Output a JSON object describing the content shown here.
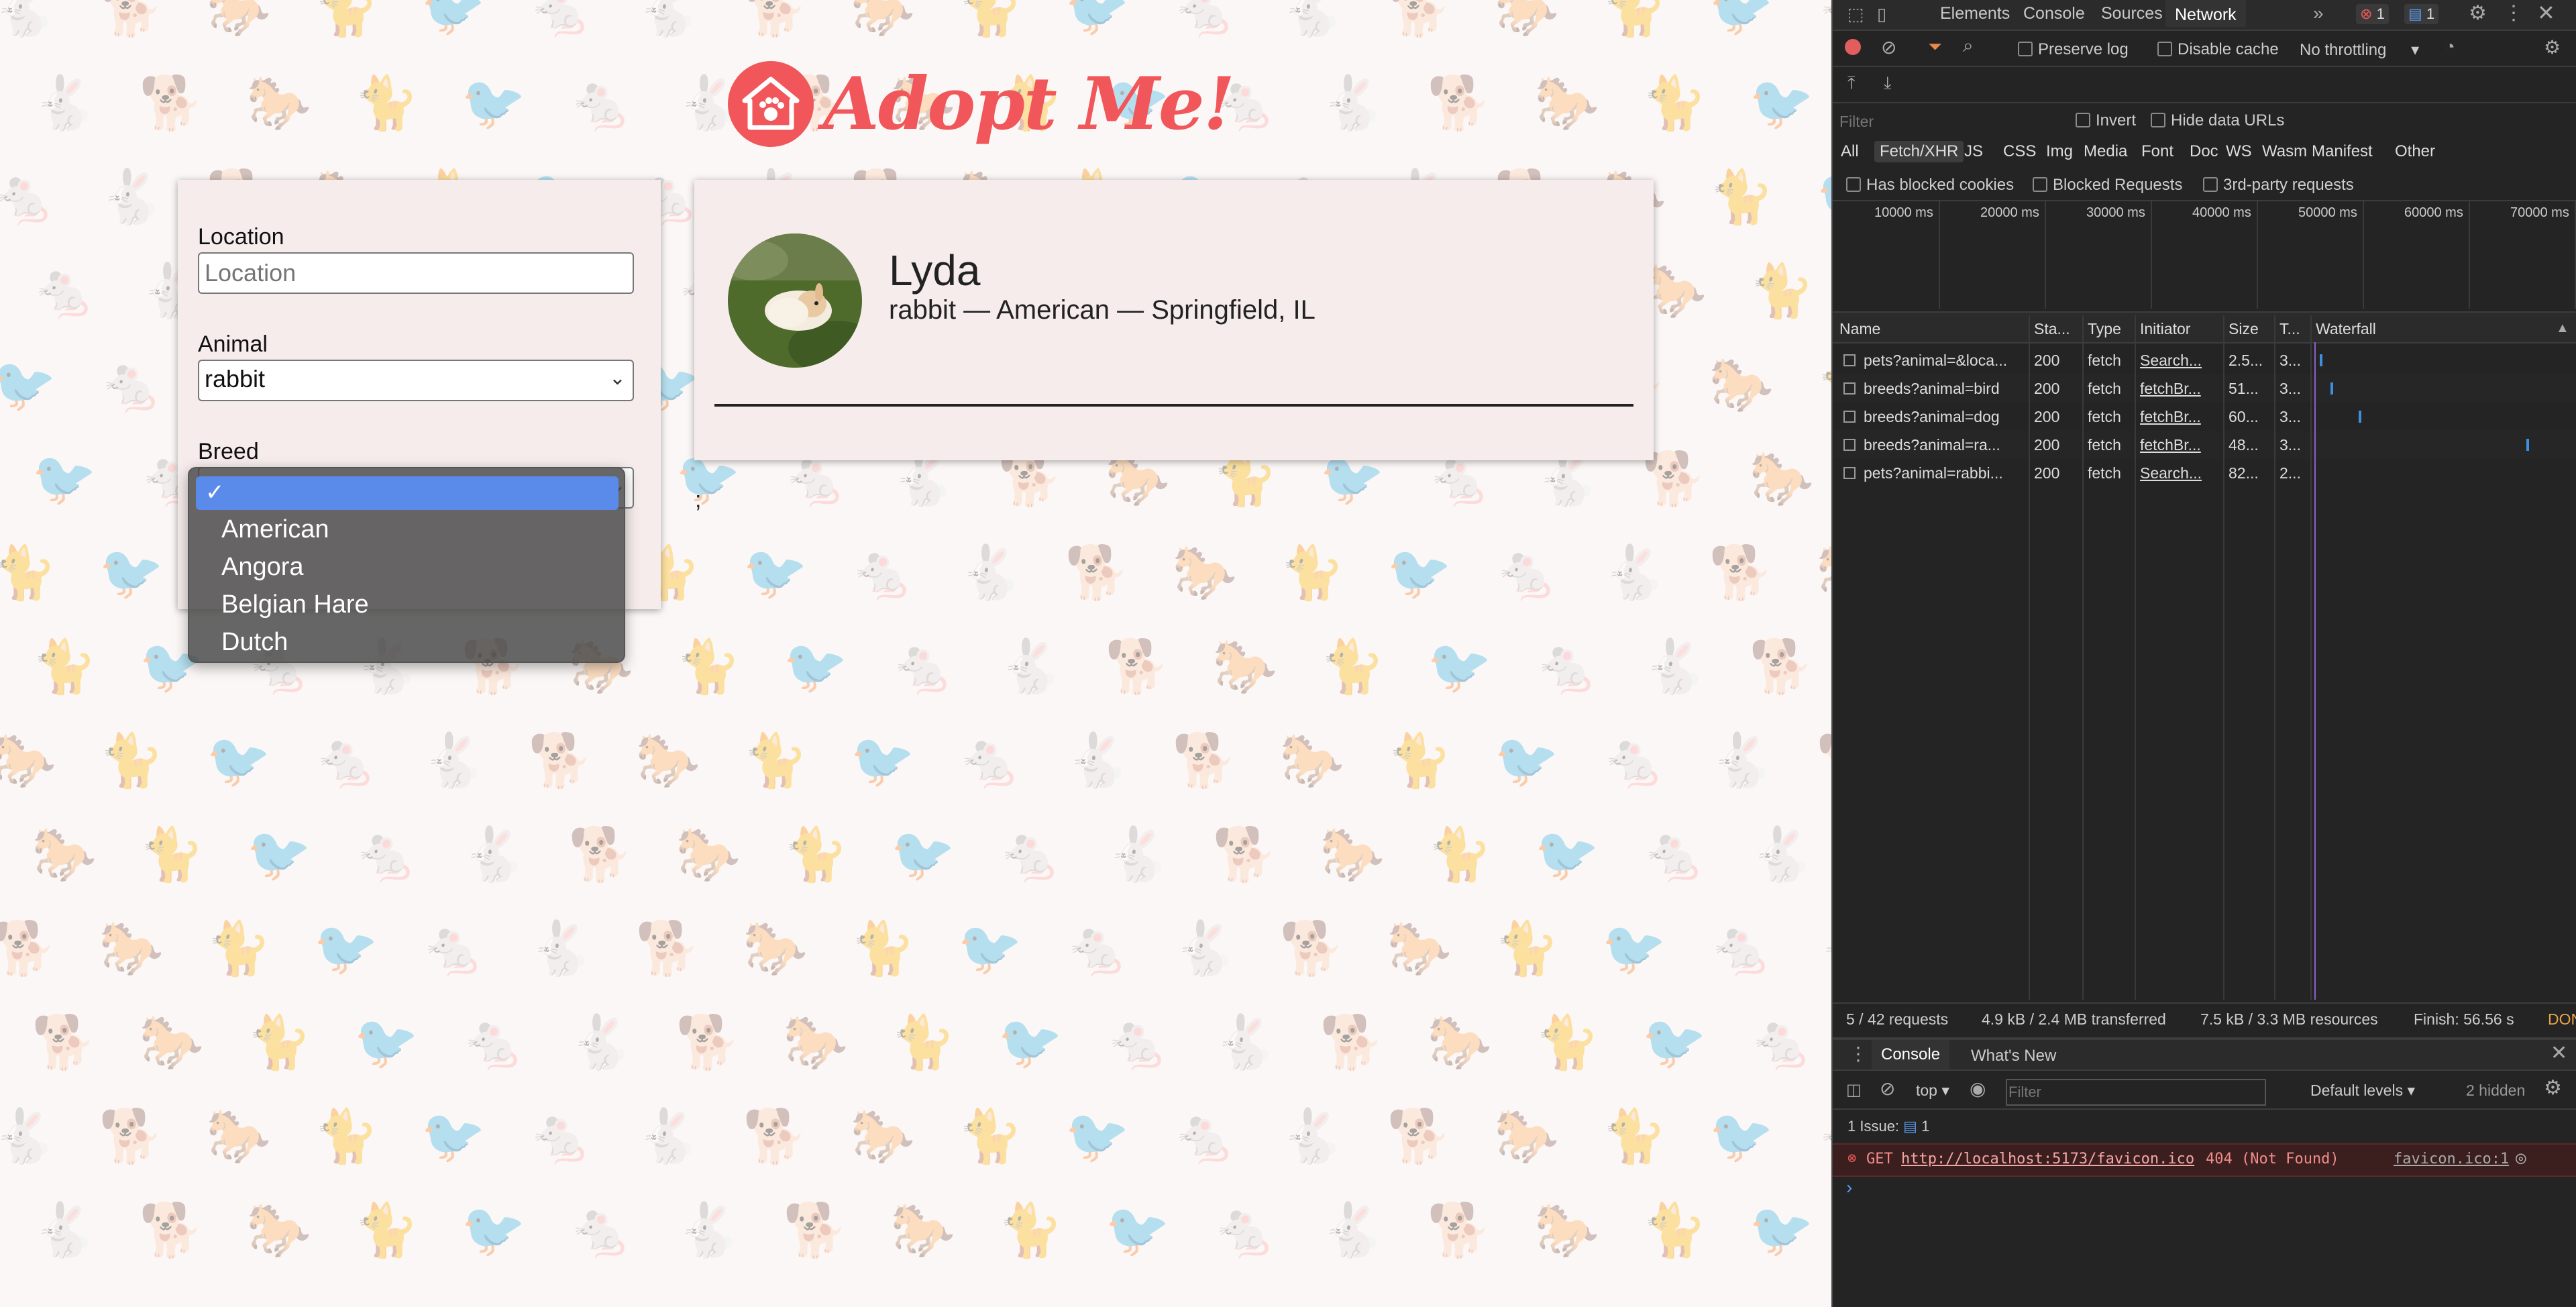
{
  "app": {
    "logo_text": "Adopt Me!",
    "location": {
      "label": "Location",
      "placeholder": "Location",
      "value": ""
    },
    "animal": {
      "label": "Animal",
      "value": "rabbit"
    },
    "breed": {
      "label": "Breed",
      "selected": "",
      "checkmark": "✓",
      "options": [
        "American",
        "Angora",
        "Belgian Hare",
        "Dutch"
      ]
    },
    "pet": {
      "name": "Lyda",
      "description": "rabbit — American — Springfield, IL"
    },
    "stray_text": ";"
  },
  "devtools": {
    "tabs": [
      "Elements",
      "Console",
      "Sources",
      "Network"
    ],
    "active_tab": "Network",
    "more_tabs": "»",
    "error_badge": "1",
    "message_badge": "1",
    "toolbar": {
      "preserve_log": "Preserve log",
      "disable_cache": "Disable cache",
      "throttling": "No throttling"
    },
    "filter": {
      "placeholder": "Filter",
      "invert": "Invert",
      "hide_data_urls": "Hide data URLs",
      "types": [
        "All",
        "Fetch/XHR",
        "JS",
        "CSS",
        "Img",
        "Media",
        "Font",
        "Doc",
        "WS",
        "Wasm",
        "Manifest",
        "Other"
      ],
      "active_type": "Fetch/XHR",
      "has_blocked_cookies": "Has blocked cookies",
      "blocked_requests": "Blocked Requests",
      "third_party": "3rd-party requests"
    },
    "timeline_labels": [
      "10000 ms",
      "20000 ms",
      "30000 ms",
      "40000 ms",
      "50000 ms",
      "60000 ms",
      "70000 ms"
    ],
    "columns": [
      "Name",
      "Sta...",
      "Type",
      "Initiator",
      "Size",
      "T...",
      "Waterfall"
    ],
    "requests": [
      {
        "name": "pets?animal=&loca...",
        "status": "200",
        "type": "fetch",
        "initiator": "Search...",
        "size": "2.5...",
        "time": "3..."
      },
      {
        "name": "breeds?animal=bird",
        "status": "200",
        "type": "fetch",
        "initiator": "fetchBr...",
        "size": "51...",
        "time": "3..."
      },
      {
        "name": "breeds?animal=dog",
        "status": "200",
        "type": "fetch",
        "initiator": "fetchBr...",
        "size": "60...",
        "time": "3..."
      },
      {
        "name": "breeds?animal=ra...",
        "status": "200",
        "type": "fetch",
        "initiator": "fetchBr...",
        "size": "48...",
        "time": "3..."
      },
      {
        "name": "pets?animal=rabbi...",
        "status": "200",
        "type": "fetch",
        "initiator": "Search...",
        "size": "82...",
        "time": "2..."
      }
    ],
    "status_bar": {
      "requests": "5 / 42 requests",
      "transferred": "4.9 kB / 2.4 MB transferred",
      "resources": "7.5 kB / 3.3 MB resources",
      "finish": "Finish: 56.56 s",
      "dom": "DON"
    },
    "drawer": {
      "tabs": [
        "Console",
        "What's New"
      ],
      "context": "top",
      "filter_placeholder": "Filter",
      "levels": "Default levels",
      "hidden": "2 hidden",
      "issues_label": "1 Issue:",
      "issues_count": "1",
      "error": {
        "method": "GET",
        "url": "http://localhost:5173/favicon.ico",
        "status": "404 (Not Found)",
        "source": "favicon.ico:1"
      },
      "prompt": "›"
    }
  }
}
